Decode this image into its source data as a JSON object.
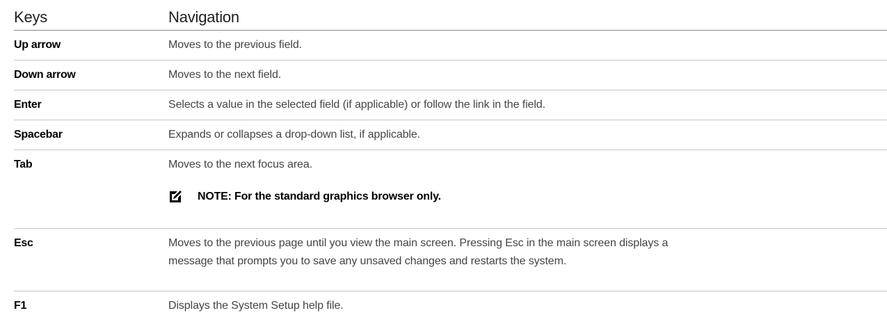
{
  "header": {
    "keys": "Keys",
    "navigation": "Navigation"
  },
  "rows": [
    {
      "key": "Up arrow",
      "desc": "Moves to the previous field."
    },
    {
      "key": "Down arrow",
      "desc": "Moves to the next field."
    },
    {
      "key": "Enter",
      "desc": "Selects a value in the selected field (if applicable) or follow the link in the field."
    },
    {
      "key": "Spacebar",
      "desc": "Expands or collapses a drop-down list, if applicable."
    },
    {
      "key": "Tab",
      "desc": "Moves to the next focus area.",
      "note": "NOTE: For the standard graphics browser only."
    },
    {
      "key": "Esc",
      "desc_line1": "Moves to the previous page until you view the main screen. Pressing Esc in the main screen displays a",
      "desc_line2": "message that prompts you to save any unsaved changes and restarts the system."
    },
    {
      "key": "F1",
      "desc": "Displays the System Setup help file."
    }
  ],
  "icons": {
    "note": "pencil-icon"
  }
}
